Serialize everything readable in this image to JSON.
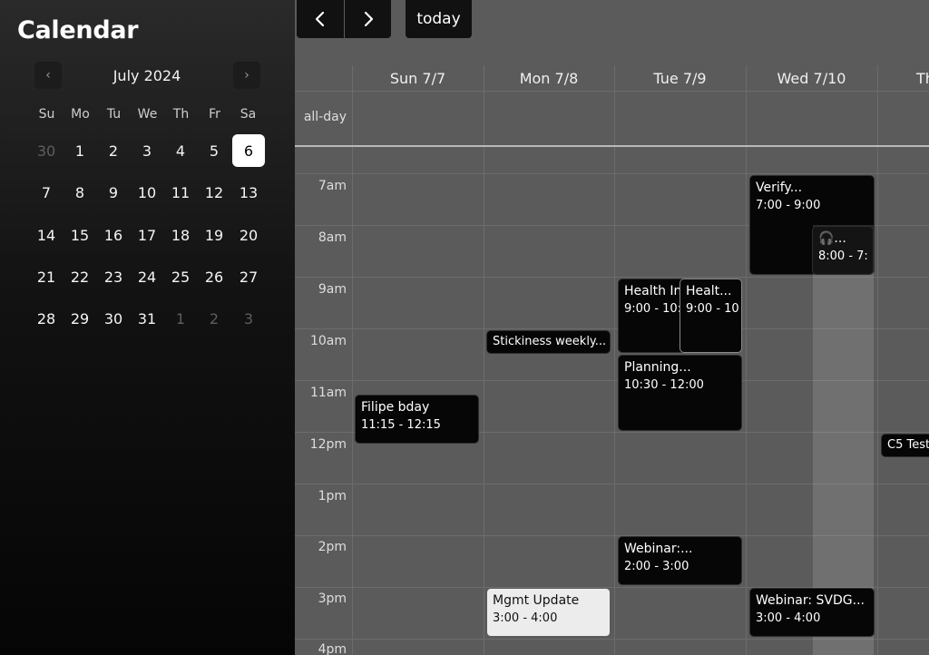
{
  "app": {
    "title": "Calendar"
  },
  "mini_calendar": {
    "month_label": "July 2024",
    "prev_icon": "chevron-left-icon",
    "next_icon": "chevron-right-icon",
    "prev_glyph": "‹",
    "next_glyph": "›",
    "weekdays": [
      "Su",
      "Mo",
      "Tu",
      "We",
      "Th",
      "Fr",
      "Sa"
    ],
    "weeks": [
      [
        "30",
        "1",
        "2",
        "3",
        "4",
        "5",
        "6"
      ],
      [
        "7",
        "8",
        "9",
        "10",
        "11",
        "12",
        "13"
      ],
      [
        "14",
        "15",
        "16",
        "17",
        "18",
        "19",
        "20"
      ],
      [
        "21",
        "22",
        "23",
        "24",
        "25",
        "26",
        "27"
      ],
      [
        "28",
        "29",
        "30",
        "31",
        "1",
        "2",
        "3"
      ]
    ],
    "selected_day": "6"
  },
  "toolbar": {
    "prev_icon": "arrow-left-icon",
    "next_icon": "arrow-right-icon",
    "today_label": "today"
  },
  "week_view": {
    "day_headers": [
      "Sun 7/7",
      "Mon 7/8",
      "Tue 7/9",
      "Wed 7/10",
      "Th"
    ],
    "allday_label": "all-day",
    "times": [
      "7am",
      "8am",
      "9am",
      "10am",
      "11am",
      "12pm",
      "1pm",
      "2pm",
      "3pm",
      "4pm"
    ]
  },
  "events": [
    {
      "title": "Verify...",
      "time": "7:00 - 9:00"
    },
    {
      "title": "🎧...",
      "time": "8:00 - 7:"
    },
    {
      "title": "Health Ins...",
      "time": "9:00 - 10:..."
    },
    {
      "title": "Healt...",
      "time": "9:00 - 10"
    },
    {
      "title": "Stickiness weekly...",
      "time": ""
    },
    {
      "title": "Planning...",
      "time": "10:30 - 12:00"
    },
    {
      "title": "Filipe bday",
      "time": "11:15 - 12:15"
    },
    {
      "title": "C5 Test",
      "time": ""
    },
    {
      "title": "Webinar:...",
      "time": "2:00 - 3:00"
    },
    {
      "title": "Mgmt Update",
      "time": "3:00 - 4:00"
    },
    {
      "title": "Webinar: SVDG...",
      "time": "3:00 - 4:00"
    }
  ]
}
